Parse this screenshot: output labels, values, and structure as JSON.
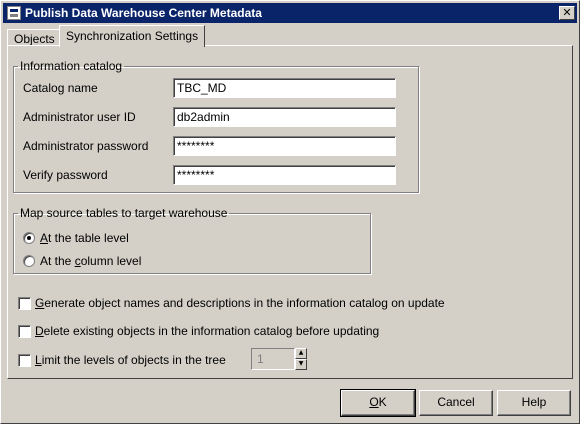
{
  "window": {
    "title": "Publish Data Warehouse Center Metadata"
  },
  "tabs": [
    {
      "label": "Objects",
      "active": false
    },
    {
      "label": "Synchronization Settings",
      "active": true
    }
  ],
  "info_catalog": {
    "legend": "Information catalog",
    "catalog_name_label": "Catalog name",
    "catalog_name_value": "TBC_MD",
    "admin_user_label": "Administrator user ID",
    "admin_user_value": "db2admin",
    "admin_password_label": "Administrator password",
    "admin_password_value": "********",
    "verify_password_label": "Verify password",
    "verify_password_value": "********"
  },
  "mapping": {
    "legend": "Map source tables to target warehouse",
    "options": [
      {
        "pre": "",
        "key": "A",
        "post": "t the table level",
        "checked": true
      },
      {
        "pre": "At the ",
        "key": "c",
        "post": "olumn level",
        "checked": false
      }
    ]
  },
  "options": {
    "generate": {
      "pre": "",
      "key": "G",
      "post": "enerate object names and descriptions in the information catalog on update",
      "checked": false
    },
    "delete": {
      "pre": "",
      "key": "D",
      "post": "elete existing objects in the information catalog before updating",
      "checked": false
    },
    "limit": {
      "pre": "",
      "key": "L",
      "post": "imit the levels of objects in the tree",
      "checked": false
    },
    "levels_value": "1"
  },
  "buttons": {
    "ok": {
      "pre": "",
      "key": "O",
      "post": "K"
    },
    "cancel": "Cancel",
    "help": "Help"
  },
  "icons": {
    "app": "warehouse-app-icon",
    "close": "close-icon",
    "spin_up": "spin-up-icon",
    "spin_down": "spin-down-icon"
  },
  "colors": {
    "titlebar": "#0a246a",
    "face": "#d4d0c8",
    "field_bg": "#ffffff"
  }
}
